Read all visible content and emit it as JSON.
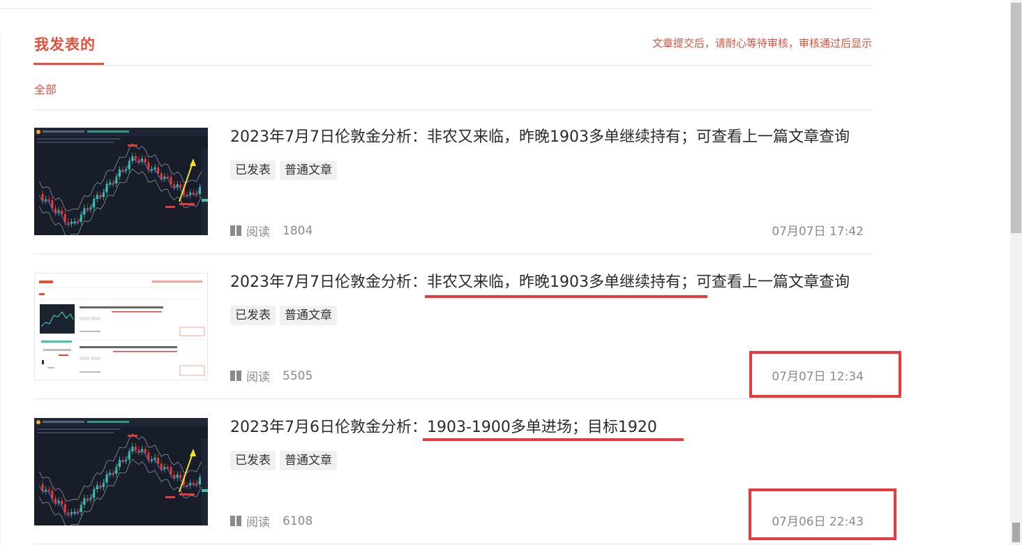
{
  "header": {
    "tab_label": "我发表的",
    "notice": "文章提交后，请耐心等待审核，审核通过后显示"
  },
  "filter": {
    "all_label": "全部"
  },
  "colors": {
    "accent": "#e0523f",
    "annotation": "#e8393b",
    "tag_bg": "#f1f1f1",
    "muted_text": "#8a8a8a"
  },
  "articles": [
    {
      "title": "2023年7月7日伦敦金分析：非农又来临，昨晚1903多单继续持有；可查看上一篇文章查询",
      "tags": [
        "已发表",
        "普通文章"
      ],
      "read_label": "阅读",
      "read_count": "1804",
      "date": "07月07日 17:42",
      "thumbnail": "candlestick-chart-dark"
    },
    {
      "title": "2023年7月7日伦敦金分析：非农又来临，昨晚1903多单继续持有；可查看上一篇文章查询",
      "tags": [
        "已发表",
        "普通文章"
      ],
      "read_label": "阅读",
      "read_count": "5505",
      "date": "07月07日 12:34",
      "thumbnail": "screenshot-light"
    },
    {
      "title": "2023年7月6日伦敦金分析：1903-1900多单进场；目标1920",
      "tags": [
        "已发表",
        "普通文章"
      ],
      "read_label": "阅读",
      "read_count": "6108",
      "date": "07月06日 22:43",
      "thumbnail": "candlestick-chart-dark"
    }
  ]
}
